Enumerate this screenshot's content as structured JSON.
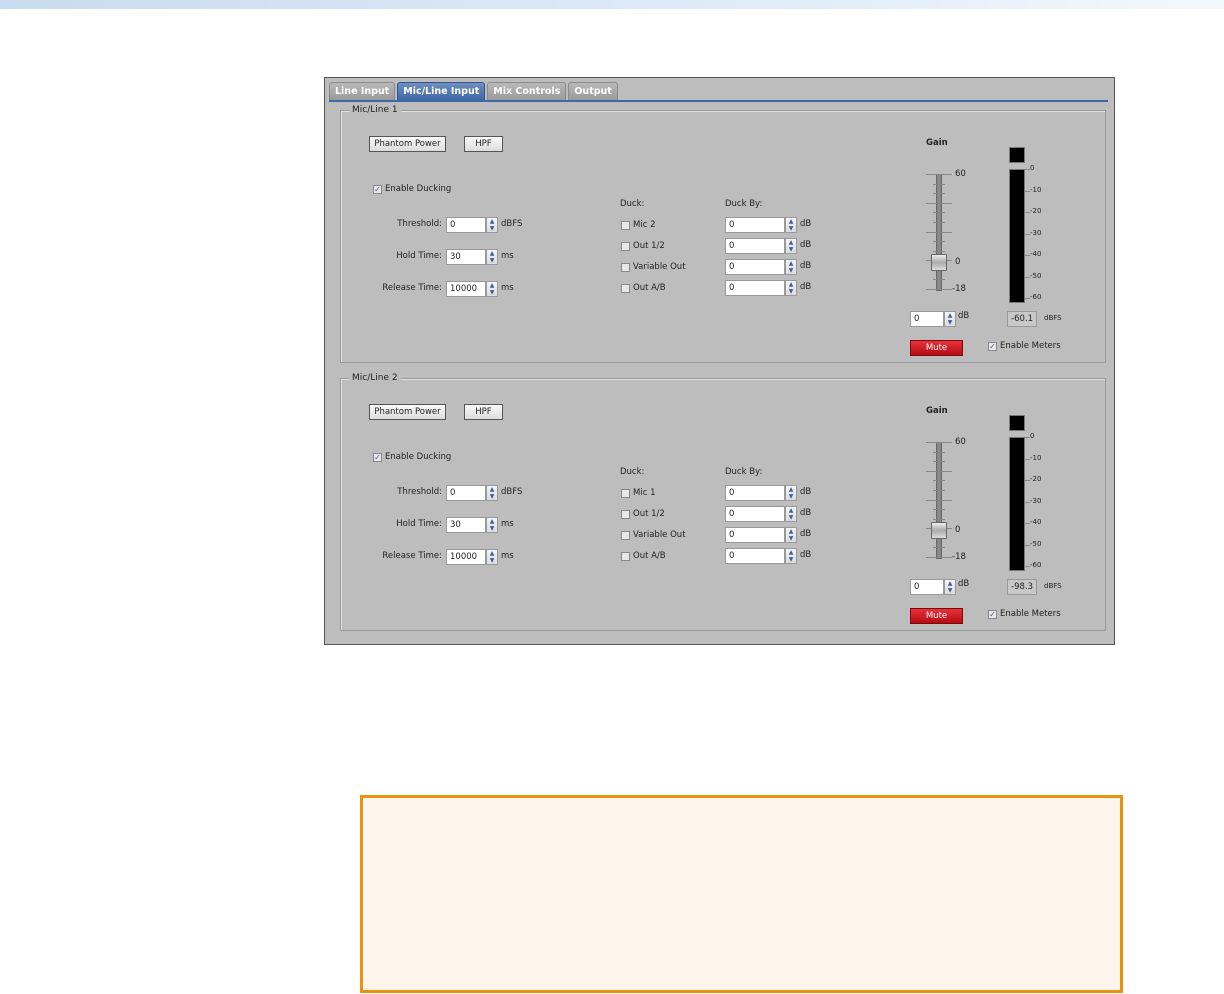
{
  "tabs": [
    "Line Input",
    "Mic/Line Input",
    "Mix Controls",
    "Output"
  ],
  "active_tab": 1,
  "groups": [
    {
      "title": "Mic/Line 1",
      "phantom_power": "Phantom Power",
      "hpf": "HPF",
      "enable_ducking": "Enable Ducking",
      "enable_ducking_checked": true,
      "threshold": {
        "label": "Threshold:",
        "value": "0",
        "unit": "dBFS"
      },
      "hold_time": {
        "label": "Hold Time:",
        "value": "30",
        "unit": "ms"
      },
      "release_time": {
        "label": "Release Time:",
        "value": "10000",
        "unit": "ms"
      },
      "duck_label": "Duck:",
      "duck_by_label": "Duck By:",
      "duck_items": [
        {
          "label": "Mic 2",
          "value": "0",
          "unit": "dB"
        },
        {
          "label": "Out 1/2",
          "value": "0",
          "unit": "dB"
        },
        {
          "label": "Variable Out",
          "value": "0",
          "unit": "dB"
        },
        {
          "label": "Out A/B",
          "value": "0",
          "unit": "dB"
        }
      ],
      "gain": {
        "label": "Gain",
        "max": "60",
        "zero": "0",
        "min": "-18",
        "value": "0",
        "unit": "dB",
        "position_db": 0
      },
      "meter": {
        "scale": [
          "0",
          "-10",
          "-20",
          "-30",
          "-40",
          "-50",
          "-60"
        ],
        "readout": "-60.1",
        "unit": "dBFS"
      },
      "mute": "Mute",
      "enable_meters": "Enable Meters",
      "enable_meters_checked": true
    },
    {
      "title": "Mic/Line 2",
      "phantom_power": "Phantom Power",
      "hpf": "HPF",
      "enable_ducking": "Enable Ducking",
      "enable_ducking_checked": true,
      "threshold": {
        "label": "Threshold:",
        "value": "0",
        "unit": "dBFS"
      },
      "hold_time": {
        "label": "Hold Time:",
        "value": "30",
        "unit": "ms"
      },
      "release_time": {
        "label": "Release Time:",
        "value": "10000",
        "unit": "ms"
      },
      "duck_label": "Duck:",
      "duck_by_label": "Duck By:",
      "duck_items": [
        {
          "label": "Mic 1",
          "value": "0",
          "unit": "dB"
        },
        {
          "label": "Out 1/2",
          "value": "0",
          "unit": "dB"
        },
        {
          "label": "Variable Out",
          "value": "0",
          "unit": "dB"
        },
        {
          "label": "Out A/B",
          "value": "0",
          "unit": "dB"
        }
      ],
      "gain": {
        "label": "Gain",
        "max": "60",
        "zero": "0",
        "min": "-18",
        "value": "0",
        "unit": "dB",
        "position_db": 0
      },
      "meter": {
        "scale": [
          "0",
          "-10",
          "-20",
          "-30",
          "-40",
          "-50",
          "-60"
        ],
        "readout": "-98.3",
        "unit": "dBFS"
      },
      "mute": "Mute",
      "enable_meters": "Enable Meters",
      "enable_meters_checked": true
    }
  ]
}
